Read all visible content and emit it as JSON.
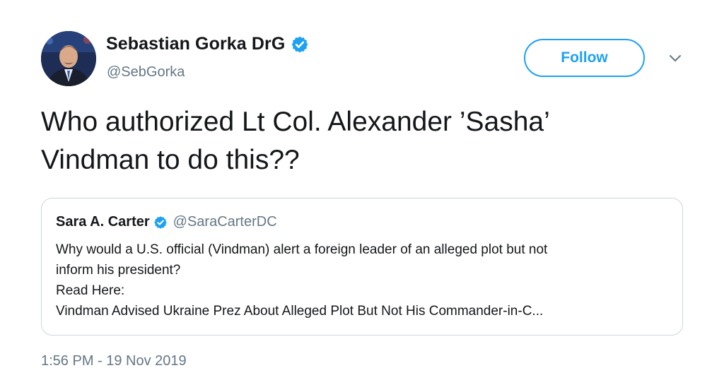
{
  "author": {
    "display_name": "Sebastian Gorka DrG",
    "handle": "@SebGorka",
    "verified": true
  },
  "follow_label": "Follow",
  "tweet": {
    "line1": "Who authorized Lt Col. Alexander ’Sasha’",
    "line2": "Vindman to do this??"
  },
  "quoted": {
    "display_name": "Sara A. Carter",
    "handle": "@SaraCarterDC",
    "verified": true,
    "line1": "Why would a U.S. official (Vindman) alert a foreign leader of an alleged plot but not",
    "line2": "inform his president?",
    "line3": "Read Here:",
    "line4": "Vindman Advised Ukraine Prez About Alleged Plot But Not His Commander-in-C..."
  },
  "timestamp": "1:56 PM - 19 Nov 2019",
  "colors": {
    "accent": "#1da1f2",
    "secondary_text": "#657786",
    "border": "#ccd6dd"
  },
  "icons": [
    "verified-badge-icon",
    "chevron-down-icon"
  ]
}
